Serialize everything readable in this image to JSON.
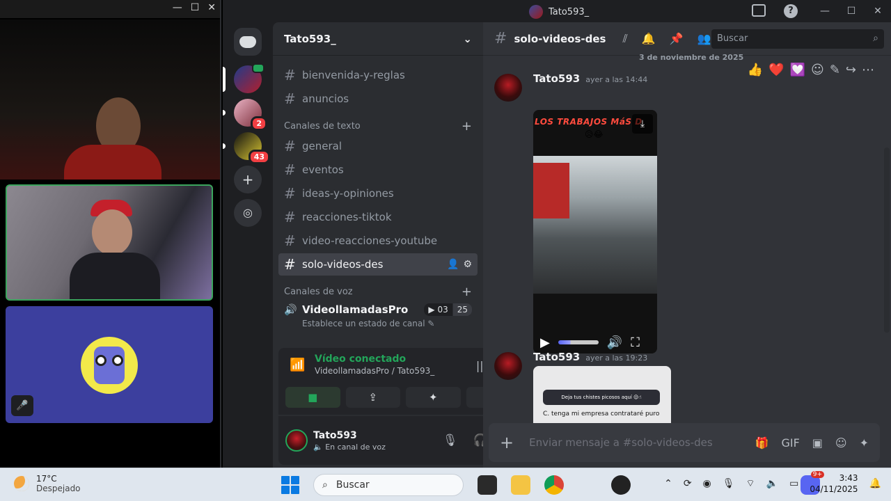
{
  "call_window": {
    "controls": [
      "—",
      "☐",
      "✕"
    ]
  },
  "window": {
    "title": "Tato593_",
    "controls": [
      "—",
      "☐",
      "✕"
    ]
  },
  "servers": {
    "badges": [
      "2",
      "43"
    ]
  },
  "guild": {
    "name": "Tato593_"
  },
  "channels": {
    "top": [
      {
        "name": "bienvenida-y-reglas"
      },
      {
        "name": "anuncios"
      }
    ],
    "text_category": "Canales de texto",
    "text": [
      {
        "name": "general"
      },
      {
        "name": "eventos"
      },
      {
        "name": "ideas-y-opiniones"
      },
      {
        "name": "reacciones-tiktok"
      },
      {
        "name": "video-reacciones-youtube"
      },
      {
        "name": "solo-videos-des",
        "active": true
      }
    ],
    "voice_category": "Canales de voz",
    "voice": {
      "name": "VideollamadasPro",
      "video_count": "03",
      "user_limit": "25",
      "status": "Establece un estado de canal"
    }
  },
  "voice_panel": {
    "status": "Vídeo conectado",
    "location": "VideollamadasPro / Tato593_"
  },
  "user": {
    "name": "Tato593",
    "status": "En canal de voz"
  },
  "chat": {
    "channel": "solo-videos-des",
    "search_placeholder": "Buscar",
    "date_divider": "3 de noviembre de 2025",
    "messages": [
      {
        "author": "Tato593",
        "time": "ayer a las 14:44",
        "video_caption": "LOS TRABAJOS MáS D",
        "video_emojis": "😥😂"
      },
      {
        "author": "Tato593",
        "time": "ayer a las 19:23",
        "image_card_text": "Deja tus chistes picosos aquí 😌☝",
        "image_line": "C. tenga mi empresa contrataré puro"
      }
    ],
    "reactions": [
      "👍",
      "❤️",
      "💟"
    ],
    "composer_placeholder": "Enviar mensaje a #solo-videos-des"
  },
  "taskbar": {
    "weather_temp": "17°C",
    "weather_desc": "Despejado",
    "search_label": "Buscar",
    "discord_badge": "9+",
    "time": "3:43",
    "date": "04/11/2025"
  }
}
